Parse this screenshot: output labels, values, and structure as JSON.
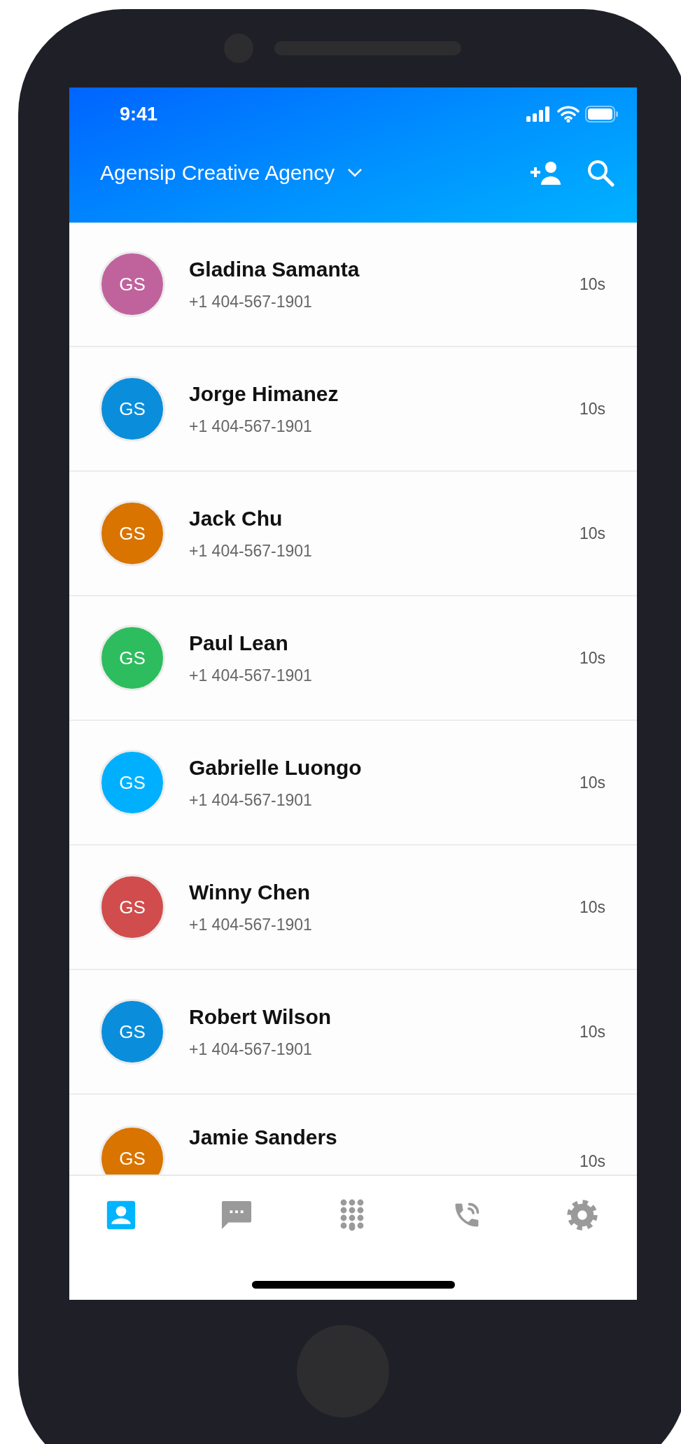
{
  "status_bar": {
    "time": "9:41"
  },
  "header": {
    "title": "Agensip Creative Agency"
  },
  "contacts": [
    {
      "initials": "GS",
      "name": "Gladina Samanta",
      "phone": "+1 404-567-1901",
      "duration": "10s",
      "color": "#c0639d"
    },
    {
      "initials": "GS",
      "name": "Jorge Himanez",
      "phone": "+1 404-567-1901",
      "duration": "10s",
      "color": "#0a8edb"
    },
    {
      "initials": "GS",
      "name": "Jack Chu",
      "phone": "+1 404-567-1901",
      "duration": "10s",
      "color": "#d97400"
    },
    {
      "initials": "GS",
      "name": "Paul Lean",
      "phone": "+1 404-567-1901",
      "duration": "10s",
      "color": "#2dbd5e"
    },
    {
      "initials": "GS",
      "name": "Gabrielle Luongo",
      "phone": "+1 404-567-1901",
      "duration": "10s",
      "color": "#00b0ff"
    },
    {
      "initials": "GS",
      "name": "Winny Chen",
      "phone": "+1 404-567-1901",
      "duration": "10s",
      "color": "#d14c4c"
    },
    {
      "initials": "GS",
      "name": "Robert Wilson",
      "phone": "+1 404-567-1901",
      "duration": "10s",
      "color": "#0a8edb"
    },
    {
      "initials": "GS",
      "name": "Jamie Sanders",
      "duration": "10s",
      "color": "#d97400"
    }
  ],
  "nav": [
    {
      "kind": "contacts",
      "selected": true
    },
    {
      "kind": "messages",
      "selected": false
    },
    {
      "kind": "dialpad",
      "selected": false
    },
    {
      "kind": "calls",
      "selected": false
    },
    {
      "kind": "settings",
      "selected": false
    }
  ]
}
